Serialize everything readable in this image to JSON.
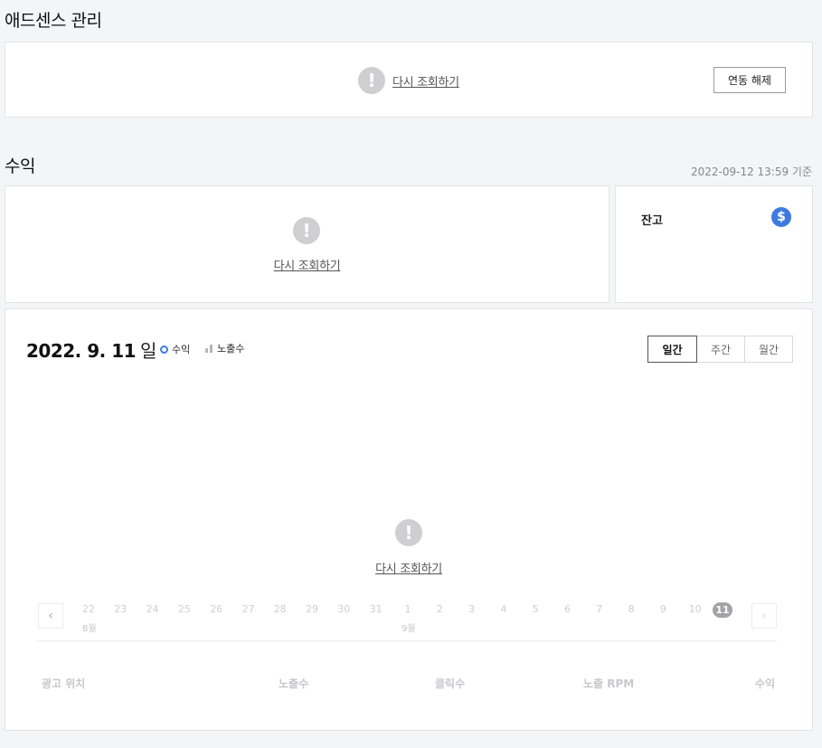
{
  "adsense": {
    "title": "애드센스 관리",
    "retry_label": "다시 조회하기",
    "unlink_label": "연동 해제"
  },
  "revenue": {
    "title": "수익",
    "timestamp": "2022-09-12 13:59 기준",
    "retry_label": "다시 조회하기",
    "balance_label": "잔고",
    "dollar_icon_glyph": "$"
  },
  "chart_panel": {
    "date_main": "2022. 9. 11",
    "date_suffix": "일",
    "legend": [
      {
        "label": "수익",
        "color": "#3d7be0"
      },
      {
        "label": "노출수",
        "color": "#b6b6b9"
      }
    ],
    "period_tabs": [
      {
        "label": "일간",
        "active": true
      },
      {
        "label": "주간",
        "active": false
      },
      {
        "label": "월간",
        "active": false
      }
    ],
    "retry_label": "다시 조회하기",
    "days": [
      "22",
      "23",
      "24",
      "25",
      "26",
      "27",
      "28",
      "29",
      "30",
      "31",
      "1",
      "2",
      "3",
      "4",
      "5",
      "6",
      "7",
      "8",
      "9",
      "10",
      "11"
    ],
    "selected_day": "11",
    "month_labels": {
      "aug": "8월",
      "sep": "9월"
    },
    "table_headers": [
      "광고 위치",
      "노출수",
      "클릭수",
      "노출 RPM",
      "수익"
    ]
  },
  "colors": {
    "accent_blue": "#3d7be0",
    "error_icon": "#cfcfd1"
  }
}
